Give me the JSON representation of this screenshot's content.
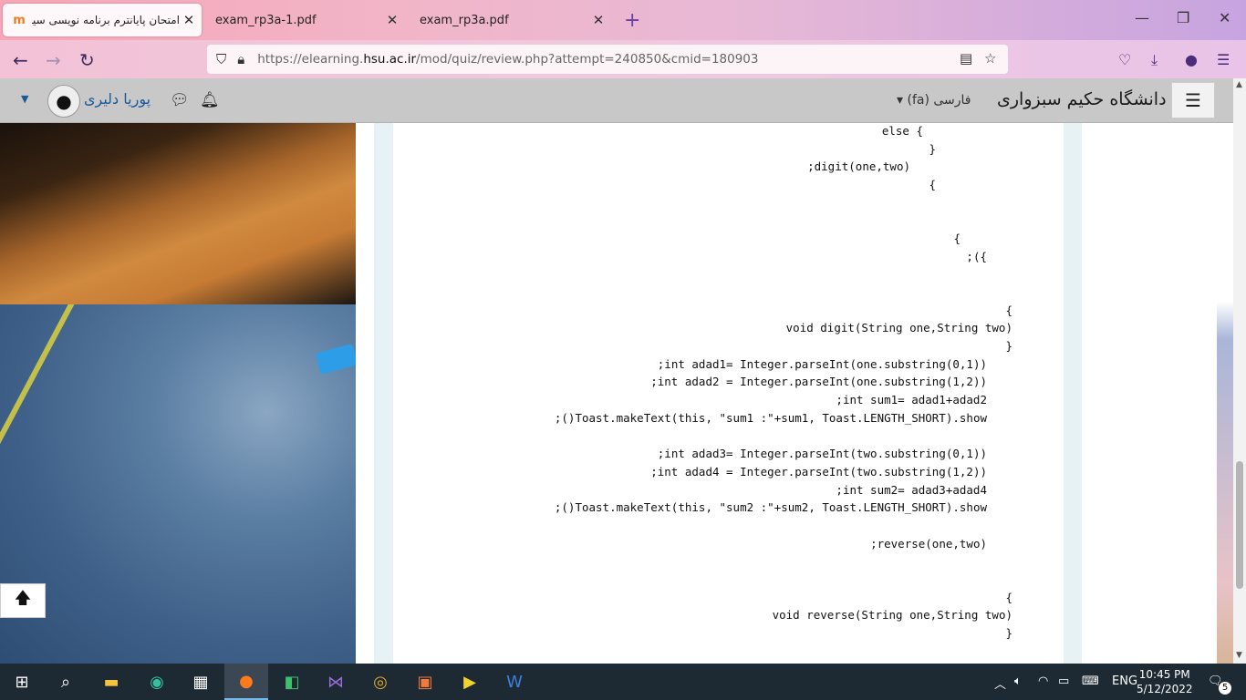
{
  "browser": {
    "tabs": [
      {
        "title": "امتحان پایانترم برنامه نویسی سیار",
        "favicon": "m"
      },
      {
        "title": "exam_rp3a-1.pdf"
      },
      {
        "title": "exam_rp3a.pdf"
      }
    ],
    "url": {
      "prefix": "https://elearning.",
      "domain": "hsu.ac.ir",
      "path": "/mod/quiz/review.php?attempt=240850&cmid=180903"
    }
  },
  "header": {
    "site_name": "دانشگاه حکیم سبزواری",
    "language": "فارسی (fa)",
    "user_name": "پوریا دلیری"
  },
  "code_lines": [
    "else {",
    "}",
    ";digit(one,two)",
    "{",
    "{",
    ";({",
    "{",
    "void digit(String one,String two)",
    "}",
    ";int adad1= Integer.parseInt(one.substring(0,1))",
    ";int adad2 = Integer.parseInt(one.substring(1,2))",
    ";int sum1= adad1+adad2",
    ";()Toast.makeText(this, \"sum1 :\"+sum1, Toast.LENGTH_SHORT).show",
    ";int adad3= Integer.parseInt(two.substring(0,1))",
    ";int adad4 = Integer.parseInt(two.substring(1,2))",
    ";int sum2= adad3+adad4",
    ";()Toast.makeText(this, \"sum2 :\"+sum2, Toast.LENGTH_SHORT).show",
    ";reverse(one,two)",
    "{",
    "void reverse(String one,String two)",
    "}"
  ],
  "taskbar": {
    "language": "ENG",
    "time": "10:45 PM",
    "date": "5/12/2022",
    "notification_count": "5"
  }
}
